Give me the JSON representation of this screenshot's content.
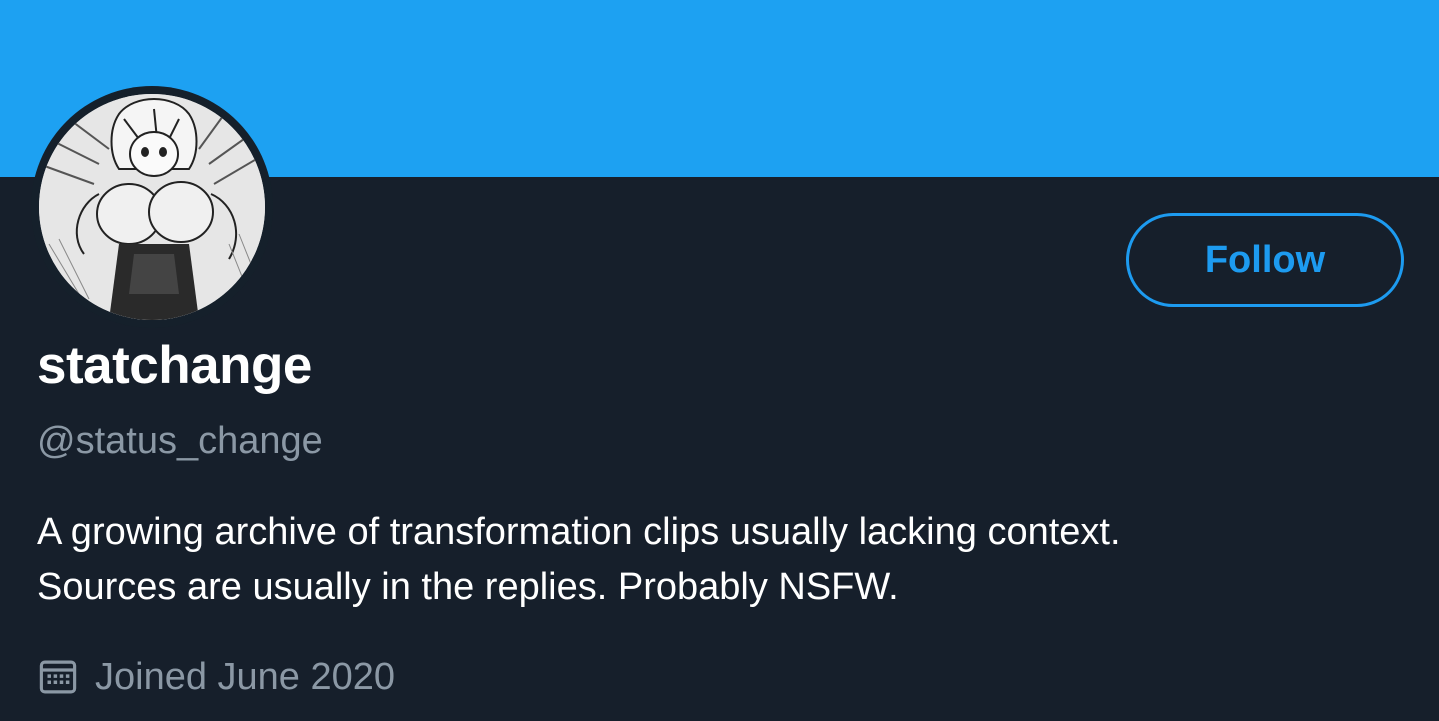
{
  "profile": {
    "display_name": "statchange",
    "handle": "@status_change",
    "bio_lines": [
      "A growing archive of transformation clips usually lacking context.",
      "Sources are usually in the replies. Probably NSFW."
    ],
    "joined": "Joined June 2020",
    "follow_label": "Follow"
  },
  "icons": {
    "joined": "calendar-icon"
  },
  "colors": {
    "banner": "#1da1f2",
    "background": "#15202b",
    "accent": "#1d9bf0",
    "secondary_text": "#8b98a5",
    "primary_text": "#ffffff"
  }
}
